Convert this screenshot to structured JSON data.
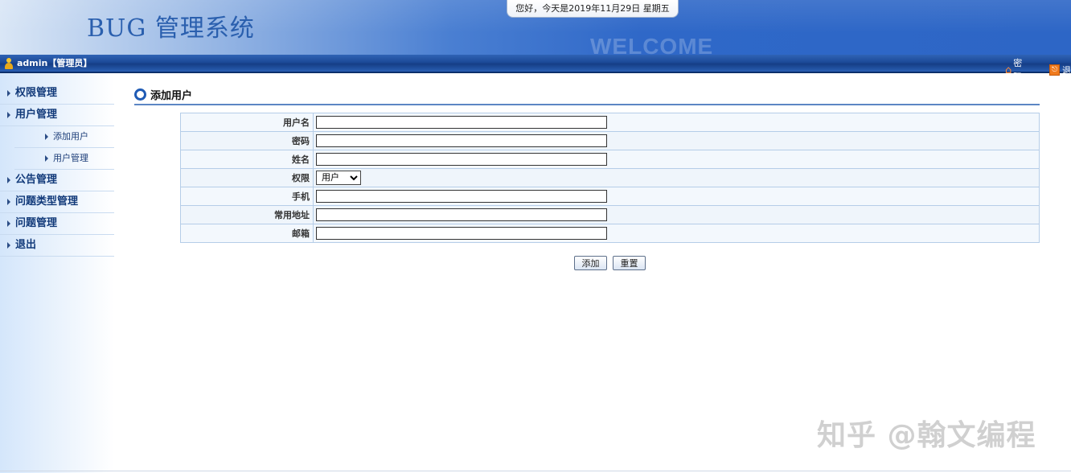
{
  "header": {
    "system_title": "BUG 管理系统",
    "date_text": "您好，今天是2019年11月29日 星期五",
    "welcome_text": "WELCOME"
  },
  "userbar": {
    "user_text": "admin【管理员】",
    "password_link": "密码",
    "exit_link": "退",
    "icons": {
      "user": "person-icon",
      "password": "home-icon",
      "exit": "exit-icon"
    }
  },
  "sidebar": {
    "items": [
      {
        "label": "权限管理"
      },
      {
        "label": "用户管理",
        "children": [
          {
            "label": "添加用户"
          },
          {
            "label": "用户管理"
          }
        ]
      },
      {
        "label": "公告管理"
      },
      {
        "label": "问题类型管理"
      },
      {
        "label": "问题管理"
      },
      {
        "label": "退出"
      }
    ]
  },
  "main": {
    "heading": "添加用户",
    "form": {
      "fields": [
        {
          "label": "用户名",
          "value": ""
        },
        {
          "label": "密码",
          "value": ""
        },
        {
          "label": "姓名",
          "value": ""
        },
        {
          "label": "权限",
          "selected": "用户"
        },
        {
          "label": "手机",
          "value": ""
        },
        {
          "label": "常用地址",
          "value": ""
        },
        {
          "label": "邮箱",
          "value": ""
        }
      ]
    },
    "buttons": {
      "add": "添加",
      "reset": "重置"
    }
  },
  "watermark": "知乎 @翰文编程",
  "colors": {
    "header_blue": "#2d66c6",
    "bar_blue": "#1c4a98",
    "accent": "#1f5bb5"
  }
}
